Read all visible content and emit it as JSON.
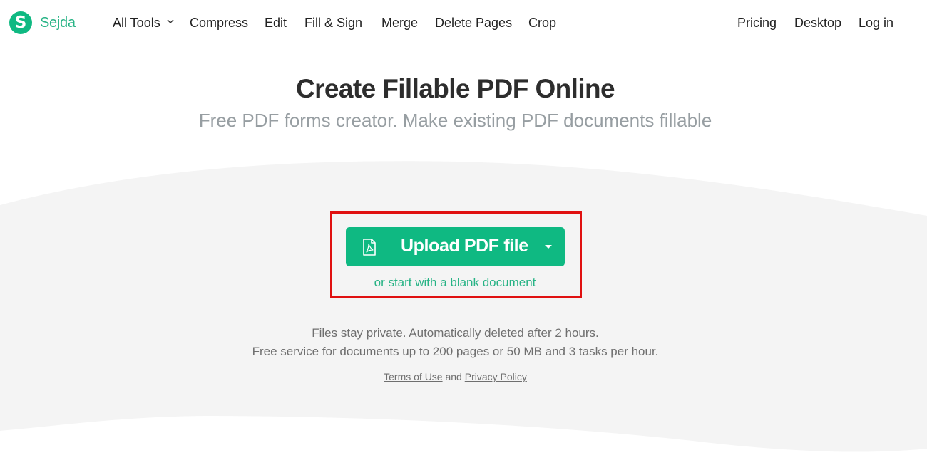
{
  "brand": {
    "logo_letter": "S",
    "name": "Sejda",
    "color": "#0fb982"
  },
  "nav": {
    "left_items": [
      {
        "label": "All Tools",
        "has_dropdown": true,
        "icon": "chevron-down-icon"
      },
      {
        "label": "Compress"
      },
      {
        "label": "Edit"
      },
      {
        "label": "Fill & Sign"
      },
      {
        "label": "Merge"
      },
      {
        "label": "Delete Pages"
      },
      {
        "label": "Crop"
      }
    ],
    "right_items": [
      {
        "label": "Pricing"
      },
      {
        "label": "Desktop"
      },
      {
        "label": "Log in"
      }
    ]
  },
  "hero": {
    "title": "Create Fillable PDF Online",
    "subtitle": "Free PDF forms creator. Make existing PDF documents fillable"
  },
  "upload": {
    "button_label": "Upload PDF file",
    "button_icon": "pdf-file-icon",
    "dropdown_icon": "caret-down-icon",
    "blank_link": "or start with a blank document",
    "highlight_color": "#e01010"
  },
  "info": {
    "line1": "Files stay private. Automatically deleted after 2 hours.",
    "line2": "Free service for documents up to 200 pages or 50 MB and 3 tasks per hour.",
    "terms_label": "Terms of Use",
    "and_label": "and",
    "privacy_label": "Privacy Policy"
  }
}
